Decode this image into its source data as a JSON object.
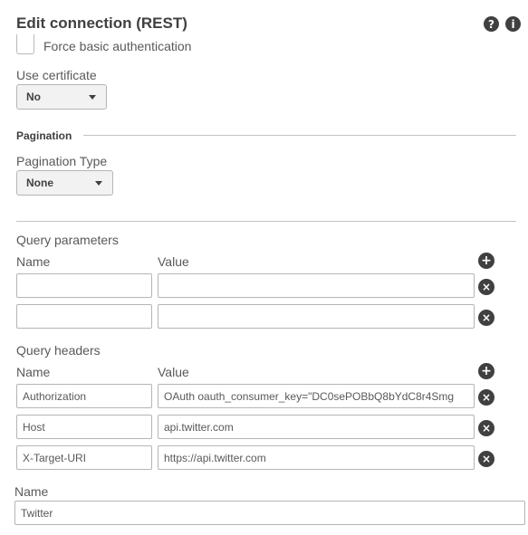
{
  "dialog": {
    "title": "Edit connection (REST)",
    "help_icon": "question-icon",
    "info_icon": "info-icon"
  },
  "force_basic_auth": {
    "label": "Force basic authentication",
    "checked": false
  },
  "use_certificate": {
    "label": "Use certificate",
    "value": "No"
  },
  "pagination": {
    "section_title": "Pagination",
    "type_label": "Pagination Type",
    "type_value": "None"
  },
  "query_parameters": {
    "title": "Query parameters",
    "name_header": "Name",
    "value_header": "Value",
    "rows": [
      {
        "name": "",
        "value": ""
      },
      {
        "name": "",
        "value": ""
      }
    ]
  },
  "query_headers": {
    "title": "Query headers",
    "name_header": "Name",
    "value_header": "Value",
    "rows": [
      {
        "name": "Authorization",
        "value": "OAuth oauth_consumer_key=\"DC0sePOBbQ8bYdC8r4Smg"
      },
      {
        "name": "Host",
        "value": "api.twitter.com"
      },
      {
        "name": "X-Target-URI",
        "value": "https://api.twitter.com"
      }
    ]
  },
  "connection_name": {
    "label": "Name",
    "value": "Twitter"
  },
  "colors": {
    "text": "#404040",
    "icon": "#404040",
    "border": "#b5b5b5",
    "select_bg": "#f2f2f2"
  }
}
